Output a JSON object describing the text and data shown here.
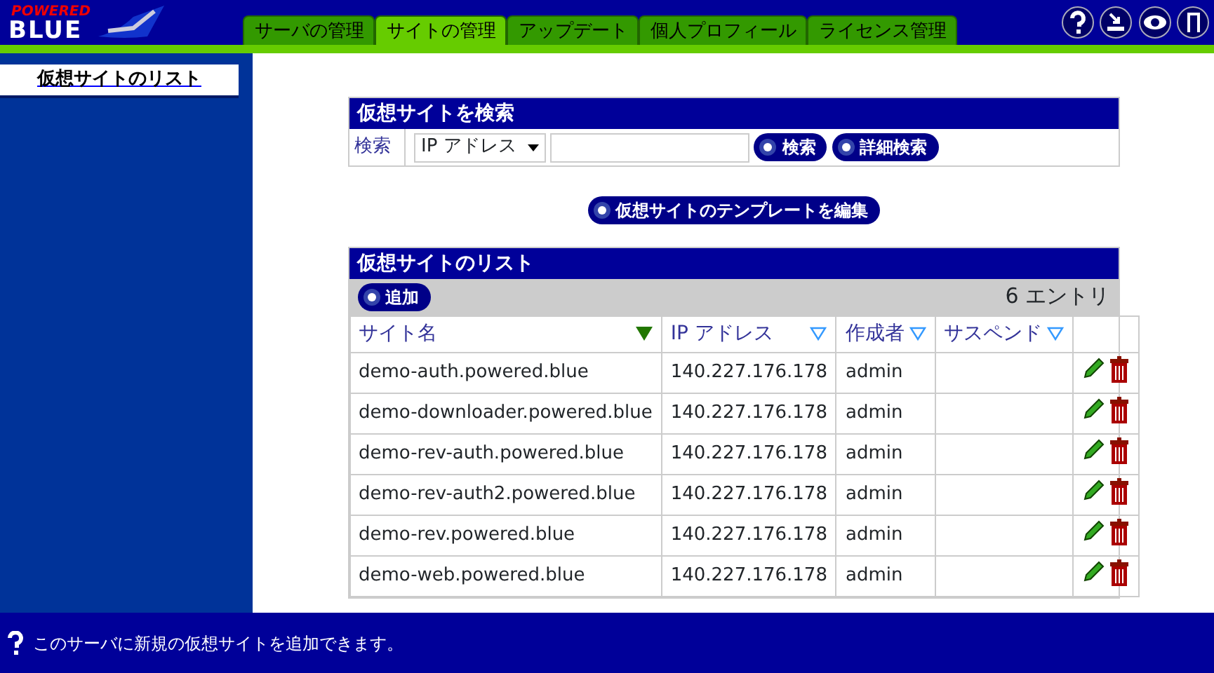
{
  "logo": {
    "line_1": "POWERED",
    "line_2": "BLUE"
  },
  "tabs": [
    {
      "label": "サーバの管理",
      "selected": false
    },
    {
      "label": "サイトの管理",
      "selected": true
    },
    {
      "label": "アップデート",
      "selected": false
    },
    {
      "label": "個人プロフィール",
      "selected": false
    },
    {
      "label": "ライセンス管理",
      "selected": false
    }
  ],
  "toolbar_icons": [
    {
      "kind": "help"
    },
    {
      "kind": "download"
    },
    {
      "kind": "view"
    },
    {
      "kind": "logout"
    }
  ],
  "sidebar": {
    "items": [
      {
        "label": "仮想サイトのリスト",
        "selected": true
      }
    ]
  },
  "search_panel": {
    "title": "仮想サイトを検索",
    "label": "検索",
    "field_select": "IP アドレス",
    "buttons": [
      "検索",
      "詳細検索"
    ]
  },
  "template_button": "仮想サイトのテンプレートを編集",
  "list_panel": {
    "title": "仮想サイトのリスト",
    "add_button": "追加",
    "entry_count": "6 エントリ",
    "columns": [
      {
        "label": "サイト名",
        "sorted": true
      },
      {
        "label": "IP アドレス",
        "sorted": false
      },
      {
        "label": "作成者",
        "sorted": false
      },
      {
        "label": "サスペンド",
        "sorted": false
      }
    ],
    "rows": [
      {
        "site": "demo-auth.powered.blue",
        "ip": "140.227.176.178",
        "creator": "admin"
      },
      {
        "site": "demo-downloader.powered.blue",
        "ip": "140.227.176.178",
        "creator": "admin"
      },
      {
        "site": "demo-rev-auth.powered.blue",
        "ip": "140.227.176.178",
        "creator": "admin"
      },
      {
        "site": "demo-rev-auth2.powered.blue",
        "ip": "140.227.176.178",
        "creator": "admin"
      },
      {
        "site": "demo-rev.powered.blue",
        "ip": "140.227.176.178",
        "creator": "admin"
      },
      {
        "site": "demo-web.powered.blue",
        "ip": "140.227.176.178",
        "creator": "admin"
      }
    ]
  },
  "status_bar": {
    "text": "このサーバに新規の仮想サイトを追加できます。"
  }
}
